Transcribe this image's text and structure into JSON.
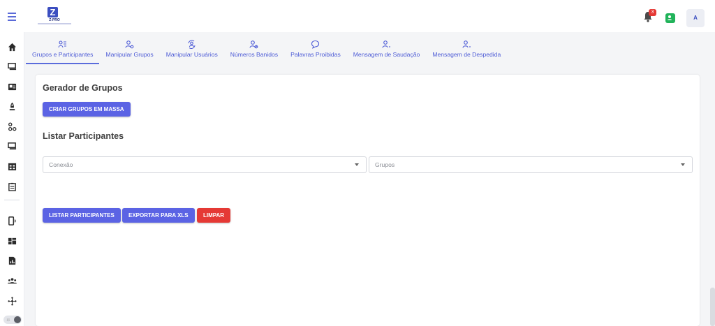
{
  "app": {
    "logo_text": "Z-PRO",
    "notification_count": "3",
    "avatar_initial": "A",
    "accent_color": "#5b63e4",
    "danger_color": "#e53935",
    "success_color": "#21b35a"
  },
  "sidebar": {
    "items": [
      {
        "icon": "home-icon"
      },
      {
        "icon": "chat-icon"
      },
      {
        "icon": "contact-card-icon"
      },
      {
        "icon": "rocket-icon"
      },
      {
        "icon": "flow-icon"
      },
      {
        "icon": "chat-bubbles-icon"
      },
      {
        "icon": "calendar-icon"
      },
      {
        "icon": "clipboard-icon"
      },
      {
        "icon": "phone-signal-icon"
      },
      {
        "icon": "dashboard-icon"
      },
      {
        "icon": "report-icon"
      },
      {
        "icon": "users-icon"
      },
      {
        "icon": "network-icon"
      }
    ]
  },
  "tabs": [
    {
      "label": "Grupos e Participantes",
      "icon": "group-list-icon",
      "active": true
    },
    {
      "label": "Manipular Grupos",
      "icon": "user-gear-icon",
      "active": false
    },
    {
      "label": "Manipular Usuários",
      "icon": "user-sync-icon",
      "active": false
    },
    {
      "label": "Números Banidos",
      "icon": "user-block-icon",
      "active": false
    },
    {
      "label": "Palavras Proibidas",
      "icon": "chat-bubble-icon",
      "active": false
    },
    {
      "label": "Mensagem de Saudação",
      "icon": "user-plus-icon",
      "active": false
    },
    {
      "label": "Mensagem de Despedida",
      "icon": "user-minus-icon",
      "active": false
    }
  ],
  "main": {
    "generator_title": "Gerador de Grupos",
    "create_groups_button": "CRIAR GRUPOS EM MASSA",
    "list_title": "Listar Participantes",
    "connection_select": {
      "placeholder": "Conexão"
    },
    "groups_select": {
      "placeholder": "Grupos"
    },
    "list_button": "LISTAR PARTICIPANTES",
    "export_button": "EXPORTAR PARA XLS",
    "clear_button": "LIMPAR"
  }
}
